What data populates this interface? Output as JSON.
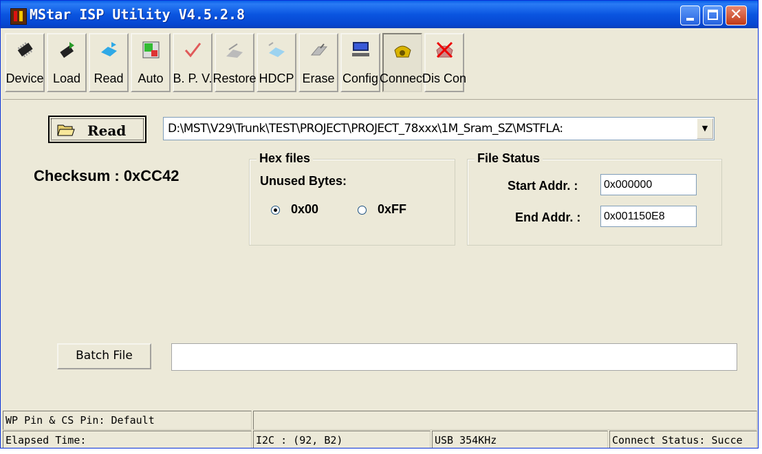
{
  "window": {
    "title": "MStar ISP Utility V4.5.2.8"
  },
  "toolbar": {
    "buttons": [
      {
        "label": "Device"
      },
      {
        "label": "Load"
      },
      {
        "label": "Read"
      },
      {
        "label": "Auto"
      },
      {
        "label": "B. P. V."
      },
      {
        "label": "Restore"
      },
      {
        "label": "HDCP"
      },
      {
        "label": "Erase"
      },
      {
        "label": "Config"
      },
      {
        "label": "Connect",
        "pressed": true
      },
      {
        "label": "Dis Con"
      }
    ]
  },
  "main": {
    "read_button": "Read",
    "file_path": "D:\\MST\\V29\\Trunk\\TEST\\PROJECT\\PROJECT_78xxx\\1M_Sram_SZ\\MSTFLA:",
    "checksum": "Checksum : 0xCC42",
    "hex_files": {
      "legend": "Hex files",
      "unused_bytes_label": "Unused Bytes:",
      "option_00": "0x00",
      "option_ff": "0xFF",
      "selected": "0x00"
    },
    "file_status": {
      "legend": "File Status",
      "start_label": "Start Addr. :",
      "start_value": "0x000000",
      "end_label": "End Addr. :",
      "end_value": "0x001150E8"
    },
    "batch_button": "Batch File",
    "batch_value": ""
  },
  "status_bar": {
    "wp_cs": "WP Pin & CS Pin: Default",
    "wp_extra": "",
    "elapsed": "Elapsed Time:",
    "i2c": "I2C :  (92,  B2)",
    "usb": "USB  354KHz",
    "connect_status": "Connect Status: Succe"
  }
}
